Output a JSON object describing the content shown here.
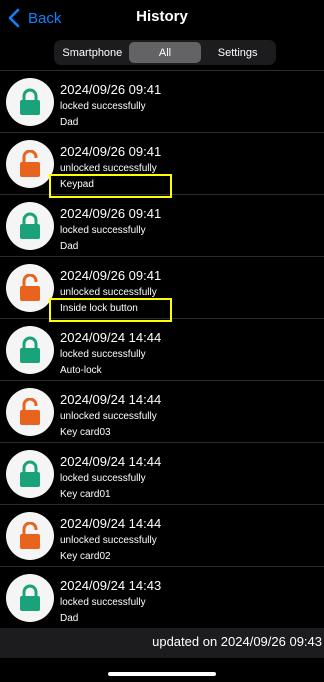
{
  "nav": {
    "back_label": "Back",
    "title": "History"
  },
  "segments": [
    {
      "label": "Smartphone",
      "selected": false
    },
    {
      "label": "All",
      "selected": true
    },
    {
      "label": "Settings",
      "selected": false
    }
  ],
  "entries": [
    {
      "time": "2024/09/26 09:41",
      "status": "locked successfully",
      "source": "Dad",
      "state": "locked",
      "highlighted": false
    },
    {
      "time": "2024/09/26 09:41",
      "status": "unlocked successfully",
      "source": "Keypad",
      "state": "unlocked",
      "highlighted": true
    },
    {
      "time": "2024/09/26 09:41",
      "status": "locked successfully",
      "source": "Dad",
      "state": "locked",
      "highlighted": false
    },
    {
      "time": "2024/09/26 09:41",
      "status": "unlocked successfully",
      "source": "Inside lock button",
      "state": "unlocked",
      "highlighted": true
    },
    {
      "time": "2024/09/24 14:44",
      "status": "locked successfully",
      "source": "Auto-lock",
      "state": "locked",
      "highlighted": false
    },
    {
      "time": "2024/09/24 14:44",
      "status": "unlocked successfully",
      "source": "Key card03",
      "state": "unlocked",
      "highlighted": false
    },
    {
      "time": "2024/09/24 14:44",
      "status": "locked successfully",
      "source": "Key card01",
      "state": "locked",
      "highlighted": false
    },
    {
      "time": "2024/09/24 14:44",
      "status": "unlocked successfully",
      "source": "Key card02",
      "state": "unlocked",
      "highlighted": false
    },
    {
      "time": "2024/09/24 14:43",
      "status": "locked successfully",
      "source": "Dad",
      "state": "locked",
      "highlighted": false
    }
  ],
  "footer": {
    "updated_text": "updated on 2024/09/26 09:43"
  },
  "colors": {
    "locked": "#1aa37a",
    "unlocked": "#e8641e",
    "accent": "#0a84ff",
    "highlight": "#ffff00"
  },
  "icons": {
    "back": "chevron-left-icon",
    "locked": "padlock-closed-icon",
    "unlocked": "padlock-open-icon"
  }
}
